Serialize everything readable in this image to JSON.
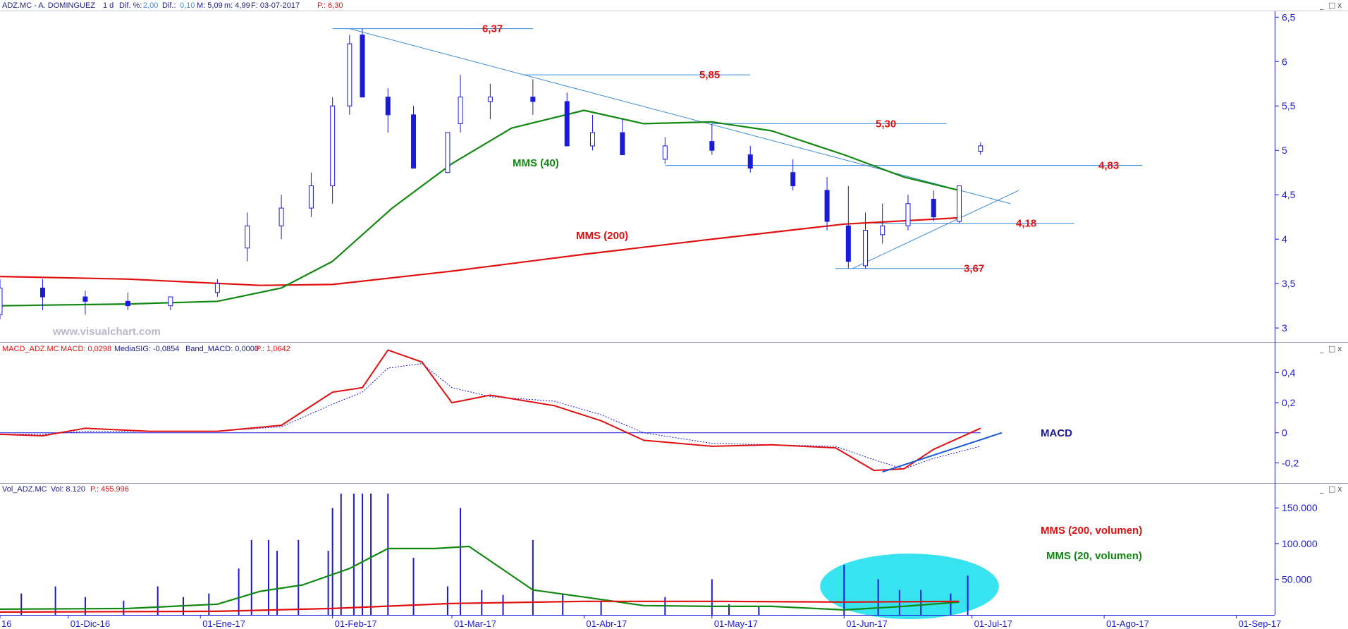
{
  "price_panel": {
    "header": {
      "symbol": "ADZ.MC - A. DOMINGUEZ",
      "timeframe": "1 d",
      "dif_pct_label": "Dif. %:",
      "dif_pct_value": "2,00",
      "dif_label": "Dif.:",
      "dif_value": "0,10",
      "max_text": "M: 5,09",
      "min_text": "m: 4,99",
      "date_text": "F: 03-07-2017",
      "price_text": "P.: 6,30"
    },
    "watermark": "www.visualchart.com",
    "y_ticks": [
      "6,5",
      "6",
      "5,5",
      "5",
      "4,5",
      "4",
      "3,5",
      "3"
    ],
    "annotations": {
      "level_637": "6,37",
      "level_585": "5,85",
      "level_530": "5,30",
      "level_483": "4,83",
      "level_418": "4,18",
      "level_367": "3,67",
      "mms40": "MMS (40)",
      "mms200": "MMS (200)"
    }
  },
  "macd_panel": {
    "header": {
      "name": "MACD_ADZ.MC",
      "macd_text": "MACD: 0,0298",
      "signal_text": "MediaSIG: -0,0854",
      "band_text": "Band_MACD: 0,0000",
      "p_text": "P.: 1,0642"
    },
    "y_ticks": [
      "0,4",
      "0,2",
      "0",
      "-0,2"
    ],
    "label": "MACD"
  },
  "volume_panel": {
    "header": {
      "name": "Vol_ADZ.MC",
      "vol_text": "Vol: 8.120",
      "p_text": "P.: 455.996"
    },
    "y_ticks": [
      "150.000",
      "100.000",
      "50.000"
    ],
    "label_200": "MMS (200, volumen)",
    "label_20": "MMS (20, volumen)"
  },
  "date_axis": [
    "16",
    "01-Dic-16",
    "01-Ene-17",
    "01-Feb-17",
    "01-Mar-17",
    "01-Abr-17",
    "01-May-17",
    "01-Jun-17",
    "01-Jul-17",
    "01-Ago-17",
    "01-Sep-17"
  ],
  "window_buttons": [
    "_",
    "□",
    "x"
  ],
  "colors": {
    "up_candle": "#ffffff",
    "down_candle": "#1a1adb",
    "mms40": "#118811",
    "mms200": "#e01010",
    "macd": "#e01010",
    "signal": "#1a1adb",
    "axis": "#1a1adb",
    "highlight": "#22e0ee"
  },
  "chart_data": [
    {
      "type": "candlestick",
      "title": "ADZ.MC - A. DOMINGUEZ",
      "ylim": [
        2.85,
        6.55
      ],
      "x_range": [
        "2016-11-15",
        "2017-09-10"
      ],
      "x": [
        "2016-11-15",
        "2016-11-25",
        "2016-12-05",
        "2016-12-15",
        "2016-12-25",
        "2017-01-05",
        "2017-01-12",
        "2017-01-20",
        "2017-01-27",
        "2017-02-01",
        "2017-02-05",
        "2017-02-08",
        "2017-02-14",
        "2017-02-20",
        "2017-02-28",
        "2017-03-03",
        "2017-03-10",
        "2017-03-20",
        "2017-03-28",
        "2017-04-03",
        "2017-04-10",
        "2017-04-20",
        "2017-05-01",
        "2017-05-10",
        "2017-05-20",
        "2017-05-28",
        "2017-06-02",
        "2017-06-06",
        "2017-06-10",
        "2017-06-16",
        "2017-06-22",
        "2017-06-28",
        "2017-07-03"
      ],
      "open": [
        3.15,
        3.45,
        3.35,
        3.3,
        3.25,
        3.4,
        3.9,
        4.15,
        4.35,
        4.6,
        5.5,
        6.3,
        5.6,
        5.4,
        4.75,
        5.3,
        5.55,
        5.6,
        5.55,
        5.05,
        5.2,
        4.9,
        5.1,
        4.95,
        4.75,
        4.55,
        4.15,
        3.7,
        4.05,
        4.15,
        4.45,
        4.2,
        4.99
      ],
      "high": [
        3.55,
        3.55,
        3.42,
        3.4,
        3.35,
        3.55,
        4.3,
        4.5,
        4.75,
        5.6,
        6.3,
        6.37,
        5.7,
        5.5,
        5.2,
        5.85,
        5.75,
        5.8,
        5.65,
        5.4,
        5.35,
        5.15,
        5.3,
        5.05,
        4.9,
        4.7,
        4.6,
        4.3,
        4.4,
        4.5,
        4.55,
        4.6,
        5.09
      ],
      "low": [
        3.1,
        3.2,
        3.15,
        3.2,
        3.2,
        3.35,
        3.75,
        4.0,
        4.25,
        4.4,
        5.4,
        5.6,
        5.2,
        4.85,
        4.75,
        5.2,
        5.35,
        5.4,
        5.3,
        5.0,
        5.0,
        4.85,
        4.95,
        4.75,
        4.55,
        4.1,
        3.67,
        3.67,
        3.95,
        4.1,
        4.2,
        4.18,
        4.95
      ],
      "close": [
        3.45,
        3.35,
        3.3,
        3.25,
        3.35,
        3.5,
        4.15,
        4.35,
        4.6,
        5.5,
        6.2,
        5.6,
        5.4,
        4.8,
        5.2,
        5.6,
        5.6,
        5.55,
        5.05,
        5.2,
        4.95,
        5.05,
        5.0,
        4.8,
        4.6,
        4.2,
        3.75,
        4.1,
        4.15,
        4.4,
        4.25,
        4.6,
        5.05
      ],
      "series": [
        {
          "name": "MMS (40)",
          "x": [
            "2016-11-15",
            "2016-12-15",
            "2017-01-05",
            "2017-01-20",
            "2017-02-01",
            "2017-02-15",
            "2017-03-01",
            "2017-03-15",
            "2017-04-01",
            "2017-04-15",
            "2017-05-01",
            "2017-05-15",
            "2017-06-01",
            "2017-06-15",
            "2017-06-28"
          ],
          "values": [
            3.25,
            3.27,
            3.3,
            3.45,
            3.75,
            4.35,
            4.85,
            5.25,
            5.45,
            5.3,
            5.32,
            5.22,
            4.95,
            4.7,
            4.55
          ]
        },
        {
          "name": "MMS (200)",
          "x": [
            "2016-11-15",
            "2016-12-15",
            "2017-01-15",
            "2017-02-01",
            "2017-03-01",
            "2017-04-01",
            "2017-05-01",
            "2017-06-01",
            "2017-06-28"
          ],
          "values": [
            3.58,
            3.55,
            3.48,
            3.49,
            3.64,
            3.83,
            4.0,
            4.17,
            4.24
          ]
        }
      ],
      "horizontal_levels": [
        6.37,
        5.85,
        5.3,
        4.83,
        4.18,
        3.67
      ]
    },
    {
      "type": "line",
      "title": "MACD",
      "ylim": [
        -0.32,
        0.58
      ],
      "x": [
        "2016-11-15",
        "2016-11-25",
        "2016-12-05",
        "2016-12-20",
        "2017-01-05",
        "2017-01-20",
        "2017-02-01",
        "2017-02-08",
        "2017-02-14",
        "2017-02-22",
        "2017-03-01",
        "2017-03-10",
        "2017-03-25",
        "2017-04-05",
        "2017-04-15",
        "2017-05-01",
        "2017-05-15",
        "2017-05-30",
        "2017-06-08",
        "2017-06-15",
        "2017-06-22",
        "2017-07-03"
      ],
      "series": [
        {
          "name": "MACD",
          "values": [
            -0.01,
            -0.02,
            0.03,
            0.01,
            0.01,
            0.05,
            0.27,
            0.3,
            0.55,
            0.47,
            0.2,
            0.25,
            0.18,
            0.08,
            -0.05,
            -0.09,
            -0.08,
            -0.1,
            -0.25,
            -0.24,
            -0.11,
            0.03
          ]
        },
        {
          "name": "MediaSIG",
          "values": [
            -0.01,
            -0.01,
            0.01,
            0.01,
            0.01,
            0.04,
            0.19,
            0.27,
            0.43,
            0.46,
            0.3,
            0.24,
            0.21,
            0.12,
            0.0,
            -0.07,
            -0.08,
            -0.09,
            -0.18,
            -0.24,
            -0.17,
            -0.09
          ]
        }
      ],
      "hline": 0
    },
    {
      "type": "bar",
      "title": "Vol_ADZ.MC",
      "ylim": [
        0,
        170000
      ],
      "x": [
        "2016-11-20",
        "2016-11-28",
        "2016-12-05",
        "2016-12-14",
        "2016-12-22",
        "2016-12-28",
        "2017-01-03",
        "2017-01-10",
        "2017-01-13",
        "2017-01-17",
        "2017-01-19",
        "2017-01-24",
        "2017-01-31",
        "2017-02-01",
        "2017-02-03",
        "2017-02-06",
        "2017-02-08",
        "2017-02-10",
        "2017-02-14",
        "2017-02-20",
        "2017-02-28",
        "2017-03-03",
        "2017-03-08",
        "2017-03-13",
        "2017-03-20",
        "2017-03-27",
        "2017-04-05",
        "2017-04-20",
        "2017-05-01",
        "2017-05-05",
        "2017-05-12",
        "2017-06-01",
        "2017-06-09",
        "2017-06-14",
        "2017-06-19",
        "2017-06-26",
        "2017-06-30"
      ],
      "values": [
        30000,
        40000,
        25000,
        20000,
        40000,
        25000,
        30000,
        65000,
        105000,
        105000,
        90000,
        105000,
        90000,
        150000,
        175000,
        175000,
        175000,
        175000,
        175000,
        80000,
        40000,
        150000,
        35000,
        28000,
        105000,
        30000,
        20000,
        25000,
        50000,
        15000,
        12000,
        70000,
        50000,
        35000,
        35000,
        30000,
        55000
      ],
      "series": [
        {
          "name": "MMS (200, volumen)",
          "x": [
            "2016-11-15",
            "2017-01-05",
            "2017-02-01",
            "2017-03-01",
            "2017-04-01",
            "2017-05-01",
            "2017-06-01",
            "2017-06-28"
          ],
          "values": [
            4000,
            5000,
            9000,
            16000,
            19000,
            19000,
            18000,
            19000
          ]
        },
        {
          "name": "MMS (20, volumen)",
          "x": [
            "2016-11-15",
            "2016-12-15",
            "2017-01-05",
            "2017-01-15",
            "2017-01-25",
            "2017-02-05",
            "2017-02-14",
            "2017-02-25",
            "2017-03-05",
            "2017-03-20",
            "2017-04-01",
            "2017-04-15",
            "2017-05-01",
            "2017-05-15",
            "2017-06-01",
            "2017-06-15",
            "2017-06-28"
          ],
          "values": [
            8000,
            9000,
            15000,
            33000,
            42000,
            65000,
            93000,
            93000,
            96000,
            35000,
            25000,
            13000,
            12000,
            12000,
            7000,
            12000,
            18000
          ]
        }
      ]
    }
  ]
}
